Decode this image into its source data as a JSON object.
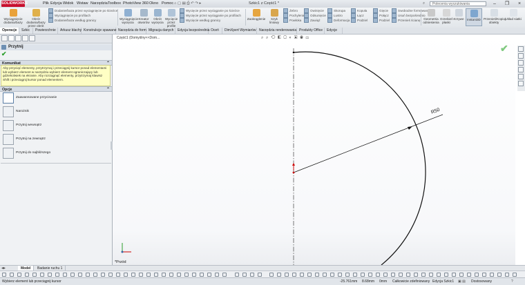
{
  "app": {
    "logo": "SOLIDWORKS",
    "document_title": "Szkic1 z Część1 *"
  },
  "menu": [
    "Plik",
    "Edycja",
    "Widok",
    "Wstaw",
    "Narzędzia",
    "Toolbox",
    "PhotoView 360",
    "Okno",
    "Pomoc"
  ],
  "search": {
    "placeholder": "Polecenia wyszukiwania"
  },
  "command_manager": {
    "big_left": [
      {
        "label": "Wyciągnięcie dodania/bazy"
      },
      {
        "label": "Obrót dodania/bazy przez obrót"
      }
    ],
    "col1": [
      "Dodanie/baza przez wyciągnięcie po ścieżce",
      "Wyciągnięcie po profilach",
      "Dodanie/baza według granicy"
    ],
    "big_mid": [
      {
        "label": "Wyciągnięcie wycięcia"
      },
      {
        "label": "Kreator otworów"
      },
      {
        "label": "Obrót wycięcia"
      },
      {
        "label": "Wycięcie przez profile"
      }
    ],
    "col2": [
      "Wycięcie przez wyciąganie po ścieżce",
      "Wycięcie przez wyciąganie po profilach",
      "Wycięcie według granicy"
    ],
    "big_fillet": {
      "label": "Zaokrąglenie"
    },
    "big_linear": {
      "label": "Szyk liniowy"
    },
    "col3": [
      "Żebro",
      "Pochylenie",
      "Powłoka"
    ],
    "col4": [
      "Owinięcie",
      "Odsunięcie",
      "Zawiąż"
    ],
    "col5": [
      "Skorupa",
      "Lustro",
      "Deformacja"
    ],
    "col6": [
      "Kopuła",
      "Łącz",
      "Podziel"
    ],
    "col7": [
      "Gięcie",
      "Połącz",
      "Podziel"
    ],
    "col8": [
      "Swobodne formowanie",
      "Usuń bezpośrednio",
      "Przenieś ścianę"
    ],
    "big_right": [
      {
        "label": "Geometria odniesienia"
      },
      {
        "label": "Grzebień płaski"
      },
      {
        "label": "Krzywe"
      },
      {
        "label": "Instant3D"
      },
      {
        "label": "Przenieś/Kopiuj obiekty"
      },
      {
        "label": "Układ siatki"
      }
    ]
  },
  "tabs": [
    "Operacje",
    "Szkic",
    "Powierzchnie",
    "Arkusz blachy",
    "Konstrukcje spawane",
    "Narzędzia do form",
    "Migracja danych",
    "Edycja bezpośrednia",
    "Oceń",
    "DimXpert Wymiarów",
    "Narzędzia renderowania",
    "Produkty Office",
    "Edycje"
  ],
  "panel": {
    "title": "Przytnij",
    "message_header": "Komunikat",
    "message_text": "Aby przyciąć elementy, przytrzymaj i przeciągnij kursor ponad elementami lub wybierz element w narzędziu wybierz element ograniczający lub gdziekolwiek na ekranie. Aby rozciągnąć elementy, przytrzymaj klawisz Shift i przeciągnij kursor ponad elementem.",
    "options_header": "Opcje",
    "options": [
      "Zaawansowane przycinanie",
      "Narożnik",
      "Przytnij wewnątrz",
      "Przytnij na zewnątrz",
      "Przytnij do najbliższego"
    ]
  },
  "viewport": {
    "breadcrumb": "Część1 (Domyślny<<Dom...",
    "dimension_label": "R50",
    "view_label": "*Przód",
    "hud_icons": "⌕ ⌕ ⟲ ◧ ▢ ◐ ▣ ◉ ▭"
  },
  "bottom_tabs": [
    "Model",
    "Badanie ruchu 1"
  ],
  "status": {
    "left": "Wybierz element lub przeciągnij kursor",
    "coords": [
      "-25.761mm",
      "8.68mm",
      "0mm"
    ],
    "defined": "Całkowicie zdefiniowany",
    "editing": "Edycja Szkic1",
    "custom": "Dostosowany"
  },
  "colors": {
    "accent": "#c8102e",
    "message_bg": "#ffffc4",
    "ok": "#2a9d2a"
  }
}
